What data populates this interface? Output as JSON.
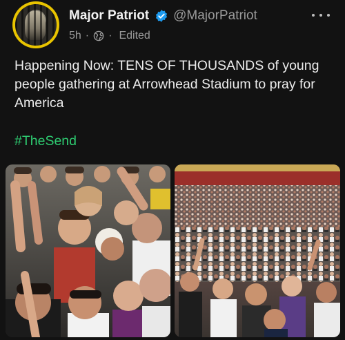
{
  "post": {
    "author": {
      "display_name": "Major Patriot",
      "handle": "@MajorPatriot",
      "verified": true,
      "avatar_border_color": "#e9c400"
    },
    "meta": {
      "age": "5h",
      "separator": "·",
      "visibility_icon": "globe-icon",
      "edited_label": "Edited"
    },
    "more_icon": "more-icon",
    "text": "Happening Now: TENS OF THOUSANDS of young people gathering at Arrowhead Stadium to pray for America",
    "hashtag": "#TheSend",
    "colors": {
      "background": "#121212",
      "hashtag": "#2ecc71",
      "verified_badge": "#1d9bf0",
      "secondary_text": "#9a9a9a"
    },
    "media": [
      {
        "kind": "photo",
        "subject": "crowd close-up"
      },
      {
        "kind": "photo",
        "subject": "stadium crowd"
      }
    ]
  }
}
